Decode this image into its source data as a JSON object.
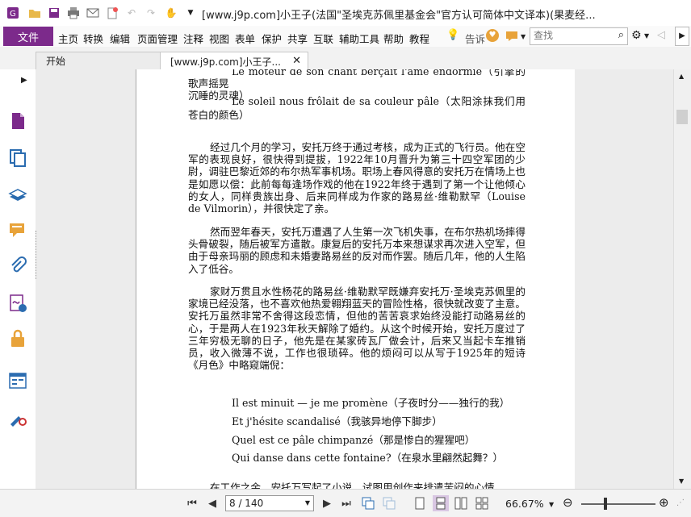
{
  "window": {
    "title": "[www.j9p.com]小王子(法国\"圣埃克苏佩里基金会\"官方认可简体中文译本)(果麦经..."
  },
  "menu": {
    "file": "文件",
    "items": [
      "主页",
      "转换",
      "编辑",
      "页面管理",
      "注释",
      "视图",
      "表单",
      "保护",
      "共享",
      "互联",
      "辅助工具",
      "帮助",
      "教程"
    ],
    "tell_me": "告诉",
    "search_placeholder": "查找"
  },
  "tabs": [
    {
      "label": "开始"
    },
    {
      "label": "[www.j9p.com]小王子..."
    }
  ],
  "document": {
    "top_line": "Le moteur de son chant berçait l'âme endormie（引擎的歌声摇晃",
    "top_line_cont": "沉睡的灵魂）",
    "verse1": "Le soleil nous frôlait de sa couleur pâle（太阳涂抹我们用苍白的颜色）",
    "para1": "经过几个月的学习，安托万终于通过考核，成为正式的飞行员。他在空军的表现良好，很快得到提拔，1922年10月晋升为第三十四空军团的少尉，调驻巴黎近郊的布尔热军事机场。职场上春风得意的安托万在情场上也是如愿以偿：此前每每逢场作戏的他在1922年终于遇到了第一个让他倾心的女人，同样贵族出身、后来同样成为作家的路易丝·维勒默罕（Louise de Vilmorin），并很快定了亲。",
    "para2": "然而翌年春天，安托万遭遇了人生第一次飞机失事，在布尔热机场摔得头骨破裂，随后被军方遣散。康复后的安托万本来想谋求再次进入空军，但由于母亲玛丽的顾虑和未婚妻路易丝的反对而作罢。随后几年，他的人生陷入了低谷。",
    "para3": "家财万贯且水性杨花的路易丝·维勒默罕既嫌弃安托万·圣埃克苏佩里的家境已经没落，也不喜欢他热爱翱翔蓝天的冒险性格，很快就改变了主意。安托万虽然非常不舍得这段恋情，但他的苦苦哀求始终没能打动路易丝的心，于是两人在1923年秋天解除了婚约。从这个时候开始，安托万度过了三年穷极无聊的日子，他先是在某家砖瓦厂做会计，后来又当起卡车推销员，收入微薄不说，工作也很琐碎。他的烦闷可以从写于1925年的短诗《月色》中略窥端倪：",
    "poem": [
      "Il est minuit — je me promène（子夜时分——独行的我）",
      "Et j'hésite scandalisé（我骇异地停下脚步）",
      "Quel est ce pâle chimpanzé（那是惨白的猩猩吧）",
      "Qui danse dans cette fontaine?（在泉水里翩然起舞？）"
    ],
    "bottom_line": "在工作之余，安托万写起了小说，试图用创作来排遣苦闷的心情。"
  },
  "status": {
    "page_indicator": "8 / 140",
    "zoom": "66.67%"
  },
  "colors": {
    "brand": "#7c2a8b",
    "accent_orange": "#e8a33a",
    "icon_blue": "#2b6cb0"
  },
  "icons": [
    "app-logo-icon",
    "open-folder-icon",
    "save-icon",
    "print-icon",
    "email-icon",
    "new-icon",
    "undo-icon",
    "redo-icon",
    "hand-icon",
    "dropdown-icon",
    "lightbulb-icon",
    "heart-icon",
    "comment-icon",
    "search-icon",
    "gear-icon",
    "nav-back-icon",
    "collapse-icon",
    "close-icon"
  ]
}
